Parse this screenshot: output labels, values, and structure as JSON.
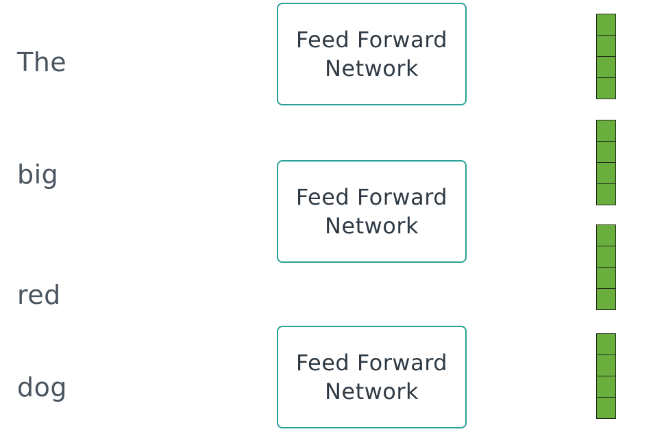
{
  "words": [
    "The",
    "big",
    "red",
    "dog"
  ],
  "ffn_blocks": [
    {
      "line1": "Feed Forward",
      "line2": "Network"
    },
    {
      "line1": "Feed Forward",
      "line2": "Network"
    },
    {
      "line1": "Feed Forward",
      "line2": "Network"
    }
  ],
  "vectors": [
    {
      "cells": 4
    },
    {
      "cells": 4
    },
    {
      "cells": 4
    },
    {
      "cells": 4
    }
  ],
  "colors": {
    "word_text": "#4a5560",
    "block_border": "#2aa198",
    "block_text": "#2f3a44",
    "vector_fill": "#6aae3e",
    "vector_border": "#1f2a1a"
  }
}
